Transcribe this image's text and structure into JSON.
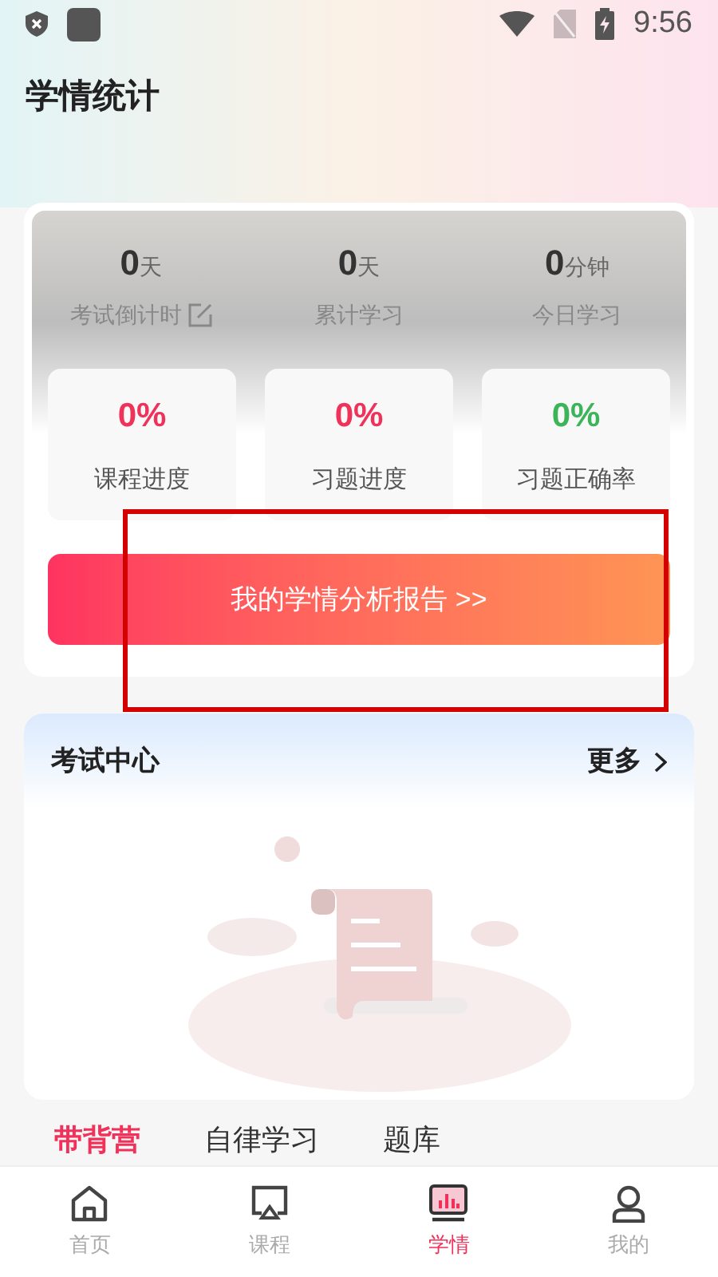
{
  "status_bar": {
    "time": "9:56"
  },
  "title": "学情统计",
  "summary": [
    {
      "value": "0",
      "unit": "天",
      "label": "考试倒计时",
      "editable": true
    },
    {
      "value": "0",
      "unit": "天",
      "label": "累计学习",
      "editable": false
    },
    {
      "value": "0",
      "unit": "分钟",
      "label": "今日学习",
      "editable": false
    }
  ],
  "progress": [
    {
      "value": "0%",
      "label": "课程进度",
      "color": "#f0325a"
    },
    {
      "value": "0%",
      "label": "习题进度",
      "color": "#f0325a"
    },
    {
      "value": "0%",
      "label": "习题正确率",
      "color": "#3cb45a"
    }
  ],
  "report_button": "我的学情分析报告 >>",
  "exam_center": {
    "title": "考试中心",
    "more": "更多"
  },
  "tabs": [
    {
      "label": "带背营",
      "selected": true
    },
    {
      "label": "自律学习",
      "selected": false
    },
    {
      "label": "题库",
      "selected": false
    }
  ],
  "nav": [
    {
      "label": "首页",
      "selected": false
    },
    {
      "label": "课程",
      "selected": false
    },
    {
      "label": "学情",
      "selected": true
    },
    {
      "label": "我的",
      "selected": false
    }
  ]
}
